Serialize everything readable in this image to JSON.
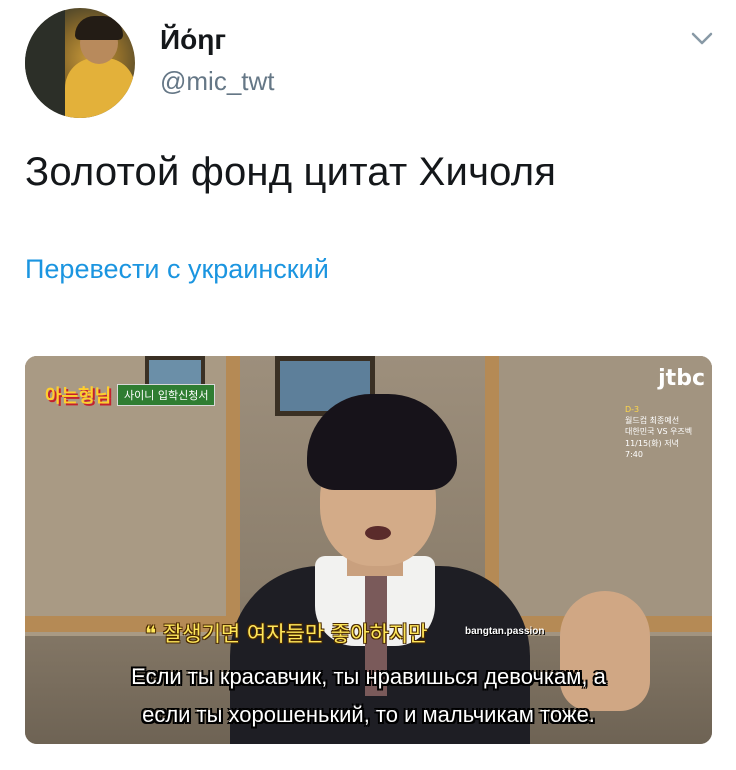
{
  "tweet": {
    "display_name": "Йόηг",
    "handle": "@mic_twt",
    "text": "Золотой фонд цитат Хичоля",
    "translate_link": "Перевести с украинский"
  },
  "media": {
    "show_logo": "아는형님",
    "show_badge": "사이니 입학신청서",
    "channel_logo": "jtbc",
    "channel_info": [
      "D-3",
      "월드컵 최종예선",
      "대한민국 VS 우즈벡",
      "11/15(화) 저녁 7:40"
    ],
    "korean_subtitle": "❝ 잘생기면 여자들만 좋아하지만",
    "watermark": "bangtan.passion",
    "subtitle_line1": "Если ты красавчик, ты нравишься девочкам, а",
    "subtitle_line2": "если ты хорошенький, то и мальчикам тоже."
  },
  "colors": {
    "link": "#1b95e0",
    "handle": "#657786",
    "text": "#14171a"
  },
  "icons": {
    "menu": "chevron-down-icon"
  }
}
